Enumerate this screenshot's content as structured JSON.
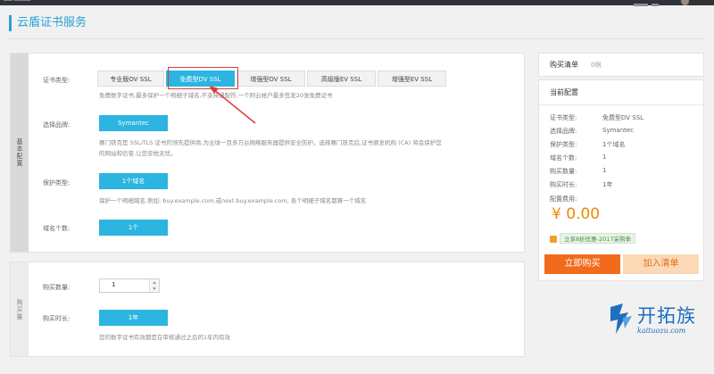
{
  "page_title": "云盾证书服务",
  "config": {
    "side_label": "基本配置",
    "cert_type_label": "证书类型:",
    "cert_tabs": [
      "专业版OV SSL",
      "免费型DV SSL",
      "增强型OV SSL",
      "高级版EV SSL",
      "增强型EV SSL"
    ],
    "cert_desc": "免费数字证书,最多保护一个明细子域名,不支持通配符,一个阿云帐户最多签发20张免费证书",
    "brand_label": "选择品牌:",
    "brand_value": "Symantec",
    "brand_desc_1": "赛门铁克是 SSL/TLS 证书的领先提供商,为全球一百多万台网络服务器提供安全防护。选择赛门铁克后,证书颁发机构 (CA) 将会保护您",
    "brand_desc_2": "的网站和信誉,让您安枕无忧。",
    "protect_label": "保护类型:",
    "protect_value": "1个域名",
    "protect_desc": "保护一个明细域名,例如: buy.example.com,或next.buy.example.com, 各个明细子域名都算一个域名",
    "domain_count_label": "域名个数:",
    "domain_count_value": "1个"
  },
  "purchase": {
    "side_label": "购买量",
    "qty_label": "购买数量:",
    "qty_value": "1",
    "duration_label": "购买时长:",
    "duration_value": "1年",
    "duration_desc": "您的数字证书有效期是在审核通过之后的1年内有效"
  },
  "cart": {
    "title": "购买清单",
    "count": "0例"
  },
  "current": {
    "title": "当前配置",
    "rows": [
      {
        "k": "证书类型:",
        "v": "免费型DV SSL"
      },
      {
        "k": "选择品牌:",
        "v": "Symantec"
      },
      {
        "k": "保护类型:",
        "v": "1个域名"
      },
      {
        "k": "域名个数:",
        "v": "1"
      },
      {
        "k": "购买数量:",
        "v": "1"
      },
      {
        "k": "购买时长:",
        "v": "1年"
      }
    ],
    "fee_label": "配置费用:",
    "price": "¥ 0.00",
    "promo": "立享8折优惠-2017采购季",
    "buy_button": "立即购买",
    "add_button": "加入清单"
  },
  "watermark": {
    "title": "开拓族",
    "url": "kaituozu.com"
  },
  "colors": {
    "accent": "#2bb5e0",
    "title_blue": "#2aa0d6",
    "highlight_red": "#e03a3a",
    "buy_orange": "#f26a1b",
    "add_orange_bg": "#fcd9b6",
    "price_orange": "#f08a00"
  }
}
